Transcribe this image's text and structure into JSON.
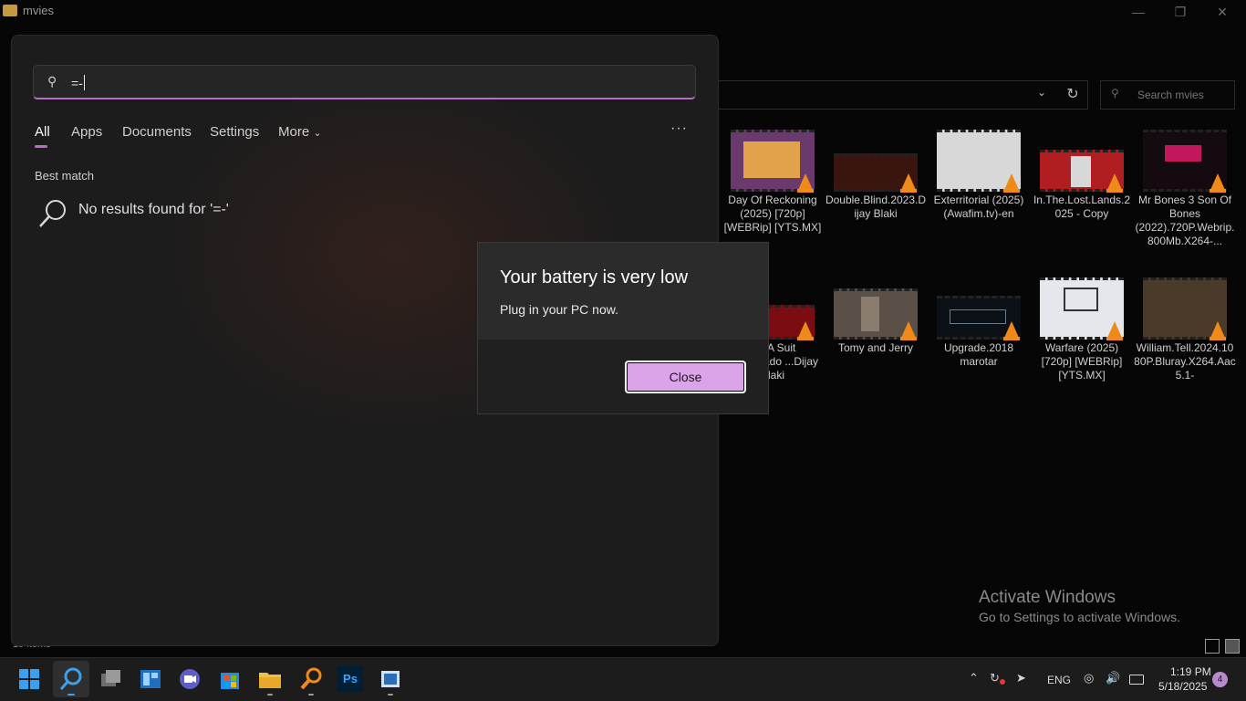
{
  "explorer": {
    "title": "mvies",
    "search_placeholder": "Search mvies",
    "status": "19 items",
    "tiles": [
      {
        "label": "Day Of Reckoning (2025) [720p] [WEBRip] [YTS.MX]"
      },
      {
        "label": "Double.Blind.2023.Dijay Blaki"
      },
      {
        "label": "Exterritorial (2025) (Awafim.tv)-en"
      },
      {
        "label": "In.The.Lost.Lands.2025 - Copy"
      },
      {
        "label": "Mr Bones 3 Son Of Bones (2022).720P.Webrip.800Mb.X264-..."
      },
      {
        "label": "...n A  Suit ...esperado ...Dijay Blaki"
      },
      {
        "label": "Tomy and Jerry"
      },
      {
        "label": "Upgrade.2018 marotar"
      },
      {
        "label": "Warfare (2025) [720p] [WEBRip] [YTS.MX]"
      },
      {
        "label": "William.Tell.2024.1080P.Bluray.X264.Aac5.1-"
      }
    ]
  },
  "watermark": {
    "title": "Activate Windows",
    "subtitle": "Go to Settings to activate Windows."
  },
  "search": {
    "query": "=-",
    "tabs": [
      "All",
      "Apps",
      "Documents",
      "Settings",
      "More"
    ],
    "best_match_label": "Best match",
    "no_results": "No results found for '=-'"
  },
  "dialog": {
    "title": "Your battery is very low",
    "message": "Plug in your PC now.",
    "close_label": "Close",
    "button_color": "#dba3e8"
  },
  "taskbar": {
    "apps": [
      "start-icon",
      "search-icon",
      "task-view-icon",
      "widgets-icon",
      "meet-icon",
      "store-icon",
      "file-explorer-icon",
      "search-tool-icon",
      "photoshop-icon",
      "media-app-icon"
    ],
    "photoshop_label": "Ps",
    "language": "ENG",
    "time": "1:19 PM",
    "date": "5/18/2025",
    "notifications": "4"
  }
}
